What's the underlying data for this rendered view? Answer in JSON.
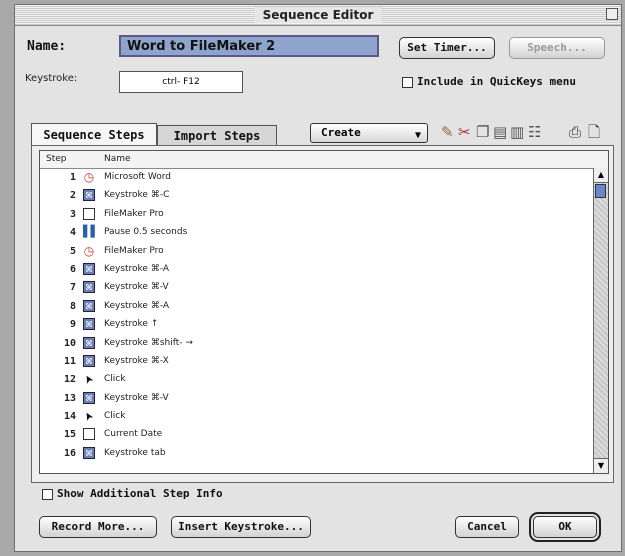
{
  "window": {
    "title": "Sequence Editor"
  },
  "header": {
    "name_label": "Name:",
    "name_value": "Word to FileMaker 2",
    "keystroke_label": "Keystroke:",
    "keystroke_value": "ctrl- F12",
    "set_timer_label": "Set Timer...",
    "speech_label": "Speech...",
    "include_label": "Include in QuicKeys menu"
  },
  "tabs": [
    {
      "label": "Sequence Steps",
      "active": true
    },
    {
      "label": "Import Steps",
      "active": false
    }
  ],
  "create_popup": {
    "label": "Create"
  },
  "toolbar_icons": [
    "pencil-icon",
    "scissors-icon",
    "copy-icon",
    "paste-icon",
    "trash-icon",
    "list-icon",
    "print-icon",
    "page-setup-icon"
  ],
  "list": {
    "columns": [
      "Step",
      "Name"
    ],
    "rows": [
      {
        "step": "1",
        "icon": "clock-icon",
        "name": "Microsoft Word"
      },
      {
        "step": "2",
        "icon": "keystroke-icon",
        "name": "Keystroke   ⌘-C"
      },
      {
        "step": "3",
        "icon": "folder-icon",
        "name": "FileMaker Pro"
      },
      {
        "step": "4",
        "icon": "pause-icon",
        "name": "Pause 0.5 seconds"
      },
      {
        "step": "5",
        "icon": "clock-icon",
        "name": "FileMaker Pro"
      },
      {
        "step": "6",
        "icon": "keystroke-icon",
        "name": "Keystroke   ⌘-A"
      },
      {
        "step": "7",
        "icon": "keystroke-icon",
        "name": "Keystroke   ⌘-V"
      },
      {
        "step": "8",
        "icon": "keystroke-icon",
        "name": "Keystroke   ⌘-A"
      },
      {
        "step": "9",
        "icon": "keystroke-icon",
        "name": "Keystroke   ↑"
      },
      {
        "step": "10",
        "icon": "keystroke-icon",
        "name": "Keystroke   ⌘shift- →"
      },
      {
        "step": "11",
        "icon": "keystroke-icon",
        "name": "Keystroke   ⌘-X"
      },
      {
        "step": "12",
        "icon": "cursor-icon",
        "name": "Click"
      },
      {
        "step": "13",
        "icon": "keystroke-icon",
        "name": "Keystroke   ⌘-V"
      },
      {
        "step": "14",
        "icon": "cursor-icon",
        "name": "Click"
      },
      {
        "step": "15",
        "icon": "folder-icon",
        "name": "Current Date"
      },
      {
        "step": "16",
        "icon": "keystroke-icon",
        "name": "Keystroke   tab"
      }
    ]
  },
  "footer": {
    "show_info_label": "Show Additional Step Info",
    "record_more_label": "Record More...",
    "insert_keystroke_label": "Insert Keystroke...",
    "cancel_label": "Cancel",
    "ok_label": "OK"
  }
}
